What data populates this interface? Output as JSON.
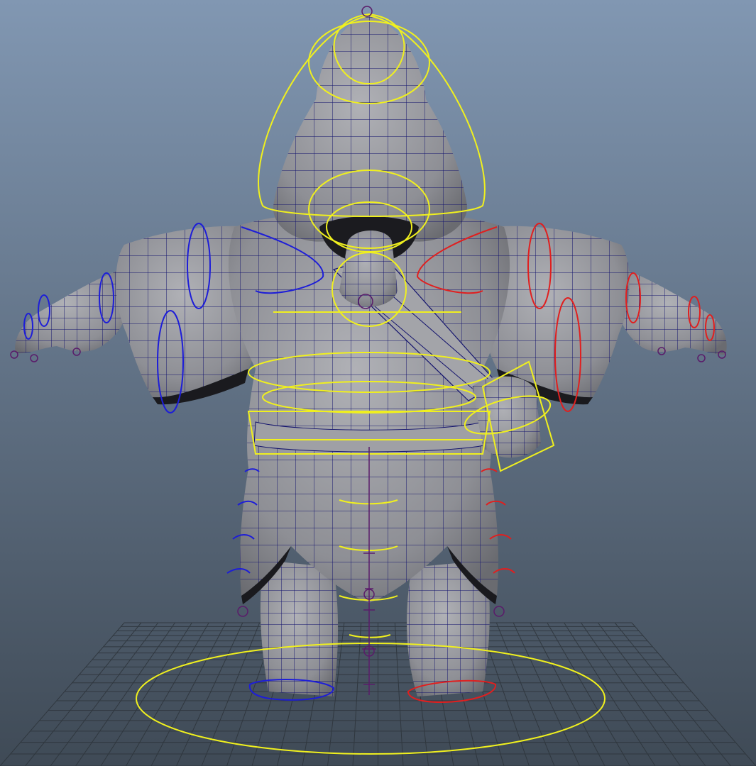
{
  "viewport": {
    "background_top": "#8197b2",
    "background_bottom": "#3f4a56"
  },
  "colors": {
    "mesh_fill": "#8e8f95",
    "mesh_shade": "#6a6b70",
    "wireframe": "#14146e",
    "center_controls": "#f0f01e",
    "left_controls": "#1d1dd8",
    "right_controls": "#e01f1f",
    "joints": "#5a1c6a",
    "grid": "#2e353c"
  },
  "scene": {
    "character_mesh": "hooded-cloak-character",
    "rig_controls": [
      "root-circle-control",
      "hood-controls",
      "spine-controls",
      "hip-controls",
      "bag-control",
      "left-arm-controls",
      "right-arm-controls",
      "left-foot-control",
      "right-foot-control"
    ]
  }
}
